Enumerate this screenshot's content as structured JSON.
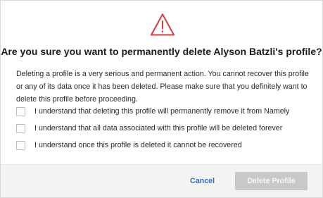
{
  "dialog": {
    "title": "Are you sure you want to permanently delete Alyson Batzli's profile?",
    "description": "Deleting a profile is a very serious and permanent action. You cannot recover this profile or any of its data once it has been deleted. Please make sure that you definitely want to delete this profile before proceeding.",
    "warning_icon": "warning-triangle-icon",
    "warning_color": "#d93a3a",
    "checkboxes": [
      {
        "label": "I understand that deleting this profile will permanently remove it from Namely",
        "checked": false
      },
      {
        "label": "I understand that all data associated with this profile will be deleted forever",
        "checked": false
      },
      {
        "label": "I understand once this profile is deleted it cannot be recovered",
        "checked": false
      }
    ],
    "footer": {
      "cancel_label": "Cancel",
      "delete_label": "Delete Profile",
      "delete_enabled": false
    }
  }
}
